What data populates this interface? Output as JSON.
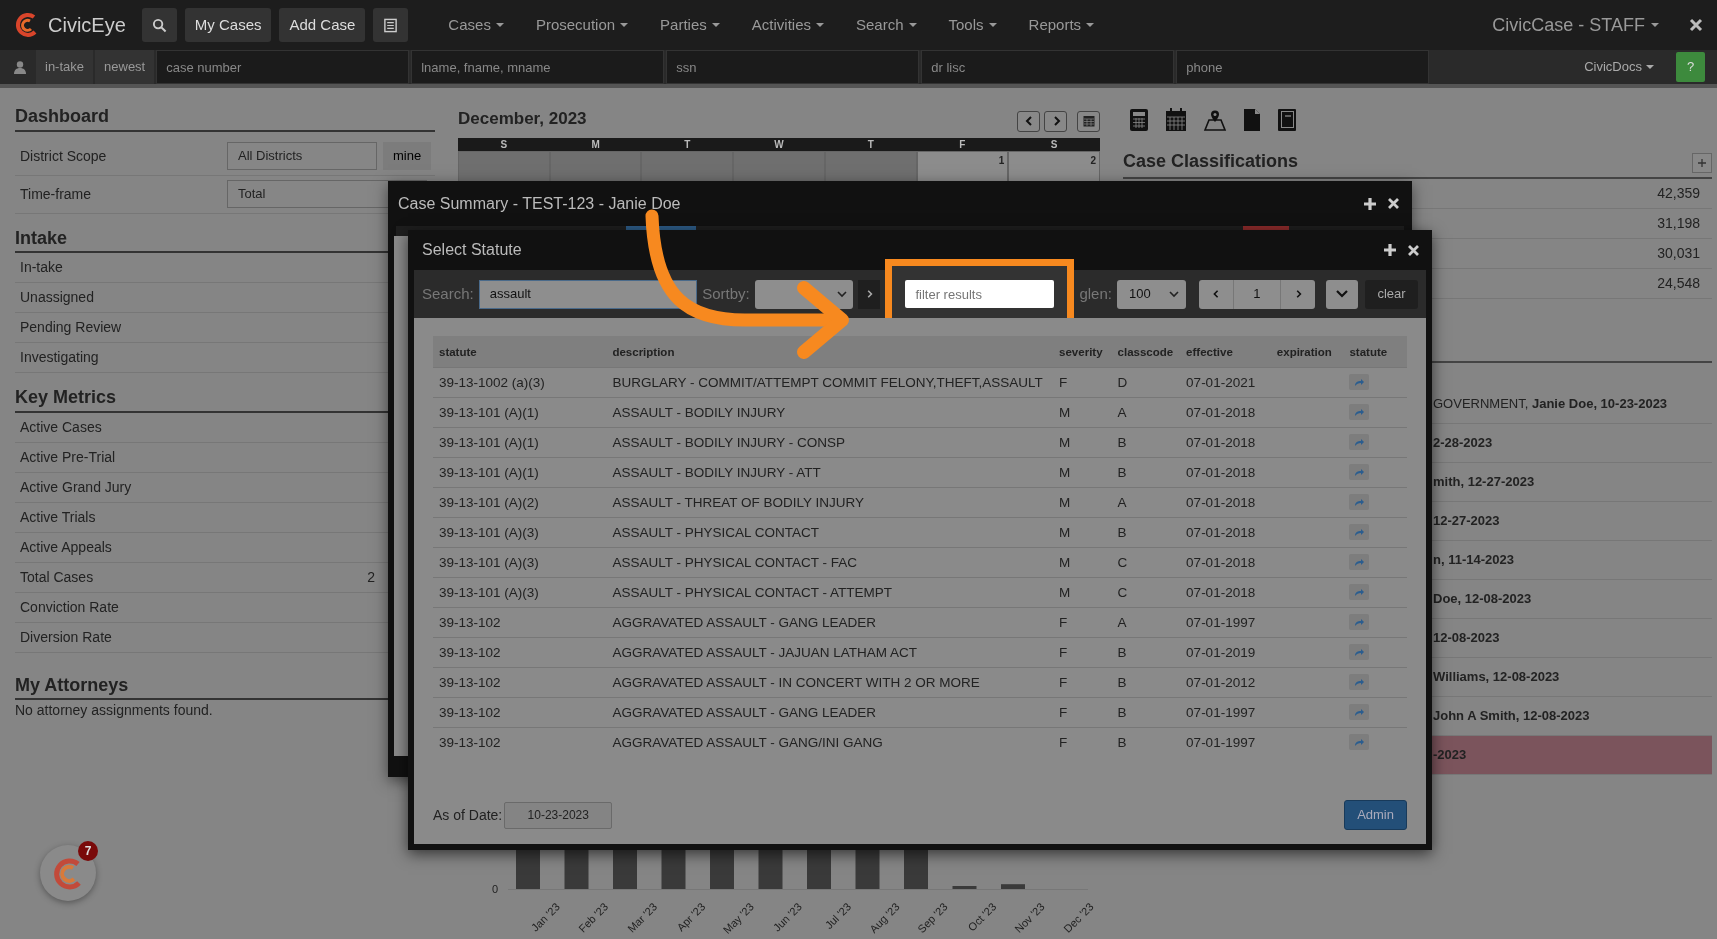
{
  "navbar": {
    "brand": "CivicEye",
    "buttons": [
      "My Cases",
      "Add Case"
    ],
    "menus": [
      "Cases",
      "Prosecution",
      "Parties",
      "Activities",
      "Search",
      "Tools",
      "Reports"
    ],
    "account": "CivicCase - STAFF"
  },
  "quickbar": {
    "tabs": [
      "in-take",
      "newest"
    ],
    "fields": [
      {
        "placeholder": "case number"
      },
      {
        "placeholder": "lname, fname, mname"
      },
      {
        "placeholder": "ssn"
      },
      {
        "placeholder": "dr lisc"
      },
      {
        "placeholder": "phone"
      }
    ],
    "docs": "CivicDocs",
    "help": "?"
  },
  "dashboard": {
    "title": "Dashboard",
    "filters": [
      {
        "label": "District Scope",
        "value": "All Districts",
        "button": "mine"
      },
      {
        "label": "Time-frame",
        "value": "Total"
      }
    ],
    "sections": [
      {
        "title": "Intake",
        "rows": [
          {
            "label": "In-take"
          },
          {
            "label": "Unassigned"
          },
          {
            "label": "Pending Review"
          },
          {
            "label": "Investigating"
          }
        ]
      },
      {
        "title": "Key Metrics",
        "rows": [
          {
            "label": "Active Cases"
          },
          {
            "label": "Active Pre-Trial"
          },
          {
            "label": "Active Grand Jury"
          },
          {
            "label": "Active Trials"
          },
          {
            "label": "Active Appeals"
          },
          {
            "label": "Total Cases",
            "value": "2"
          },
          {
            "label": "Conviction Rate"
          },
          {
            "label": "Diversion Rate"
          }
        ]
      },
      {
        "title": "My Attorneys",
        "note": "No attorney assignments found."
      }
    ]
  },
  "calendar": {
    "title": "December, 2023",
    "weekdays": [
      "S",
      "M",
      "T",
      "W",
      "T",
      "F",
      "S"
    ],
    "days": [
      {
        "other_month": true
      },
      {
        "other_month": true
      },
      {
        "other_month": true
      },
      {
        "other_month": true
      },
      {
        "other_month": true
      },
      {
        "number": "1",
        "other_month": false
      },
      {
        "number": "2",
        "other_month": false
      }
    ]
  },
  "chart": {
    "y_tick": "0",
    "labels": [
      "Jan '23",
      "Feb '23",
      "Mar '23",
      "Apr '23",
      "May '23",
      "Jun '23",
      "Jul '23",
      "Aug '23",
      "Sep '23",
      "Oct '23",
      "Nov '23",
      "Dec '23"
    ]
  },
  "case_classifications": {
    "title": "Case Classifications",
    "values": [
      "42,359",
      "31,198",
      "30,031",
      "24,548"
    ]
  },
  "recent_cases": [
    {
      "prefix": "GOVERNMENT, ",
      "text": "Janie Doe, 10-23-2023",
      "highlighted": false
    },
    {
      "text": "2-28-2023",
      "highlighted": false
    },
    {
      "text": "mith, 12-27-2023",
      "highlighted": false
    },
    {
      "text": "12-27-2023",
      "highlighted": false
    },
    {
      "text": "n, 11-14-2023",
      "highlighted": false
    },
    {
      "text": "Doe, 12-08-2023",
      "highlighted": false
    },
    {
      "text": "12-08-2023",
      "highlighted": false
    },
    {
      "text": "Williams, 12-08-2023",
      "highlighted": false
    },
    {
      "text": "John A Smith, 12-08-2023",
      "highlighted": false
    },
    {
      "text": "-2023",
      "highlighted": true
    }
  ],
  "case_summary": {
    "title": "Case Summary - TEST-123 - Janie Doe"
  },
  "statute_dialog": {
    "title": "Select Statute",
    "search_label": "Search:",
    "search_value": "assault",
    "sort_label": "Sortby:",
    "filter_placeholder": "filter results",
    "pglen_label": "glen:",
    "pglen_value": "100",
    "page": "1",
    "clear": "clear",
    "columns": [
      "statute",
      "description",
      "severity",
      "classcode",
      "effective",
      "expiration",
      "statute"
    ],
    "rows": [
      [
        "39-13-1002 (a)(3)",
        "BURGLARY - COMMIT/ATTEMPT COMMIT FELONY,THEFT,ASSAULT",
        "F",
        "D",
        "07-01-2021"
      ],
      [
        "39-13-101 (A)(1)",
        "ASSAULT - BODILY INJURY",
        "M",
        "A",
        "07-01-2018"
      ],
      [
        "39-13-101 (A)(1)",
        "ASSAULT - BODILY INJURY - CONSP",
        "M",
        "B",
        "07-01-2018"
      ],
      [
        "39-13-101 (A)(1)",
        "ASSAULT - BODILY INJURY - ATT",
        "M",
        "B",
        "07-01-2018"
      ],
      [
        "39-13-101 (A)(2)",
        "ASSAULT - THREAT OF BODILY INJURY",
        "M",
        "A",
        "07-01-2018"
      ],
      [
        "39-13-101 (A)(3)",
        "ASSAULT - PHYSICAL CONTACT",
        "M",
        "B",
        "07-01-2018"
      ],
      [
        "39-13-101 (A)(3)",
        "ASSAULT - PHYSICAL CONTACT - FAC",
        "M",
        "C",
        "07-01-2018"
      ],
      [
        "39-13-101 (A)(3)",
        "ASSAULT - PHYSICAL CONTACT - ATTEMPT",
        "M",
        "C",
        "07-01-2018"
      ],
      [
        "39-13-102",
        "AGGRAVATED ASSAULT - GANG LEADER",
        "F",
        "A",
        "07-01-1997"
      ],
      [
        "39-13-102",
        "AGGRAVATED ASSAULT - JAJUAN LATHAM ACT",
        "F",
        "B",
        "07-01-2019"
      ],
      [
        "39-13-102",
        "AGGRAVATED ASSAULT - IN CONCERT WITH 2 OR MORE",
        "F",
        "B",
        "07-01-2012"
      ],
      [
        "39-13-102",
        "AGGRAVATED ASSAULT - GANG LEADER",
        "F",
        "B",
        "07-01-1997"
      ],
      [
        "39-13-102",
        "AGGRAVATED ASSAULT - GANG/INI GANG",
        "F",
        "B",
        "07-01-1997"
      ]
    ],
    "as_of_label": "As of Date:",
    "as_of_value": "10-23-2023",
    "admin": "Admin"
  },
  "notifications": {
    "count": "7"
  }
}
